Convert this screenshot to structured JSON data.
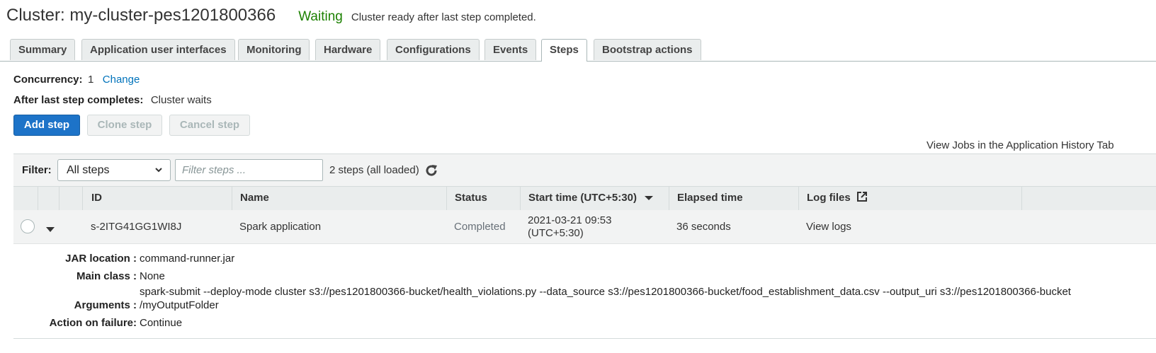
{
  "header": {
    "title": "Cluster: my-cluster-pes1201800366",
    "state": "Waiting",
    "state_description": "Cluster ready after last step completed.",
    "state_color": "#1d8102"
  },
  "tabs": [
    "Summary",
    "Application user interfaces",
    "Monitoring",
    "Hardware",
    "Configurations",
    "Events",
    "Steps",
    "Bootstrap actions"
  ],
  "active_tab": "Steps",
  "concurrency": {
    "label": "Concurrency:",
    "value": "1",
    "change_link": "Change"
  },
  "after_last_step": {
    "label": "After last step completes:",
    "value": "Cluster waits"
  },
  "buttons": {
    "add": "Add step",
    "clone": "Clone step",
    "cancel": "Cancel step"
  },
  "view_jobs_link": "View Jobs in the Application History Tab",
  "filter": {
    "label": "Filter:",
    "selected": "All steps",
    "placeholder": "Filter steps ...",
    "count_text": "2 steps (all loaded)",
    "refresh_icon": "refresh-icon"
  },
  "table": {
    "columns": {
      "id": "ID",
      "name": "Name",
      "status": "Status",
      "start": "Start time (UTC+5:30)",
      "elapsed": "Elapsed time",
      "logs": "Log files"
    },
    "rows": [
      {
        "id": "s-2ITG41GG1WI8J",
        "name": "Spark application",
        "status": "Completed",
        "start_line1": "2021-03-21 09:53",
        "start_line2": "(UTC+5:30)",
        "elapsed": "36 seconds",
        "logs": "View logs"
      }
    ]
  },
  "details": {
    "jar_label": "JAR location :",
    "jar_value": "command-runner.jar",
    "main_label": "Main class :",
    "main_value": "None",
    "args_label": "Arguments :",
    "args_line1": "spark-submit --deploy-mode cluster s3://pes1201800366-bucket/health_violations.py --data_source s3://pes1201800366-bucket/food_establishment_data.csv --output_uri s3://pes1201800366-bucket",
    "args_line2": "/myOutputFolder",
    "failure_label": "Action on failure:",
    "failure_value": "Continue"
  }
}
